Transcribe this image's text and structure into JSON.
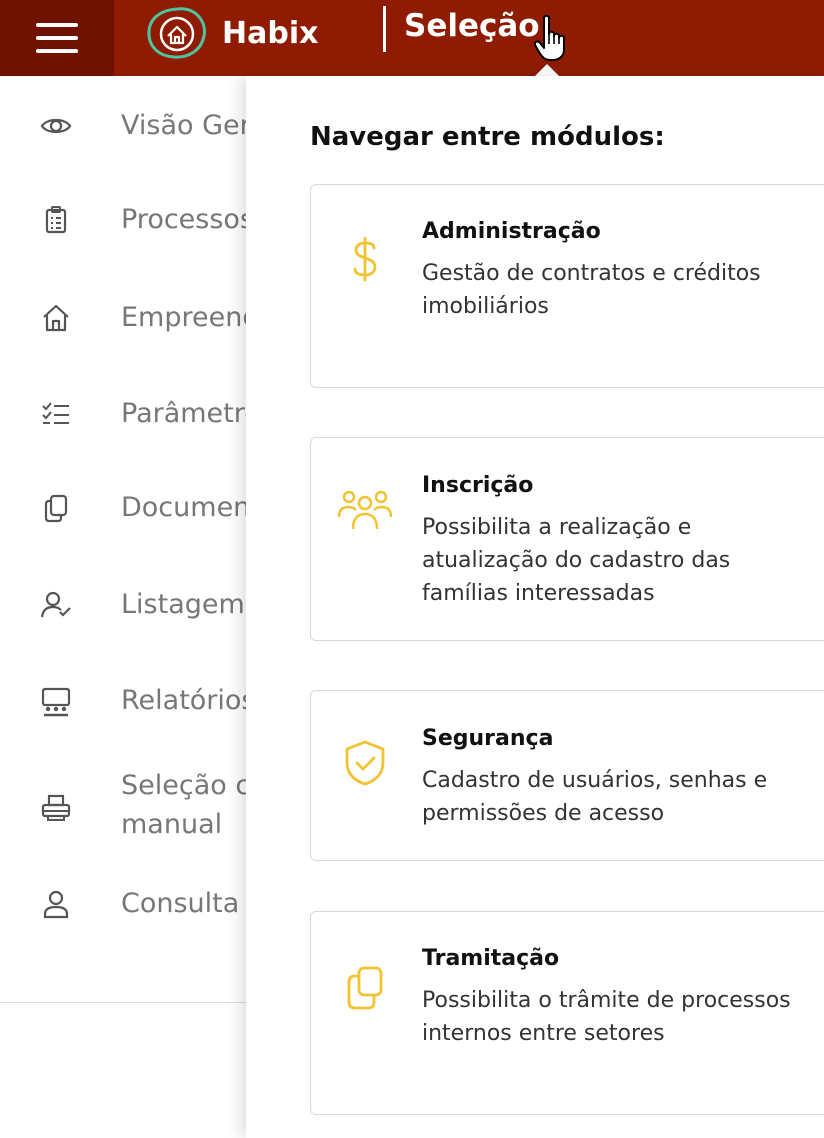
{
  "header": {
    "brand": "Habix",
    "module": "Seleção",
    "colors": {
      "bar": "#8f1c00",
      "menu": "#6f1200",
      "logo_ring": "#4fc3a1"
    }
  },
  "sidebar": {
    "items": [
      {
        "label": "Visão Geral",
        "icon": "eye-icon"
      },
      {
        "label": "Processos",
        "icon": "clipboard-icon"
      },
      {
        "label": "Empreendimentos",
        "icon": "house-icon"
      },
      {
        "label": "Parâmetros",
        "icon": "checklist-icon"
      },
      {
        "label": "Documentos",
        "icon": "copy-icon"
      },
      {
        "label": "Listagem",
        "icon": "user-check-icon"
      },
      {
        "label": "Relatórios",
        "icon": "presentation-icon"
      },
      {
        "label": "Seleção c\nmanual",
        "icon": "printer-icon"
      },
      {
        "label": "Consulta",
        "icon": "user-icon"
      }
    ]
  },
  "panel": {
    "heading": "Navegar entre módulos:",
    "accent": "#f2c230",
    "cards": [
      {
        "title": "Administração",
        "desc": "Gestão de contratos e créditos imobiliários",
        "icon": "dollar-icon"
      },
      {
        "title": "Inscrição",
        "desc": "Possibilita a realização e atualização do cadastro das famílias interessadas",
        "icon": "people-group-icon"
      },
      {
        "title": "Segurança",
        "desc": "Cadastro de usuários, senhas e permissões de acesso",
        "icon": "shield-check-icon"
      },
      {
        "title": "Tramitação",
        "desc": "Possibilita o trâmite de processos internos entre setores",
        "icon": "copy-icon"
      }
    ]
  }
}
